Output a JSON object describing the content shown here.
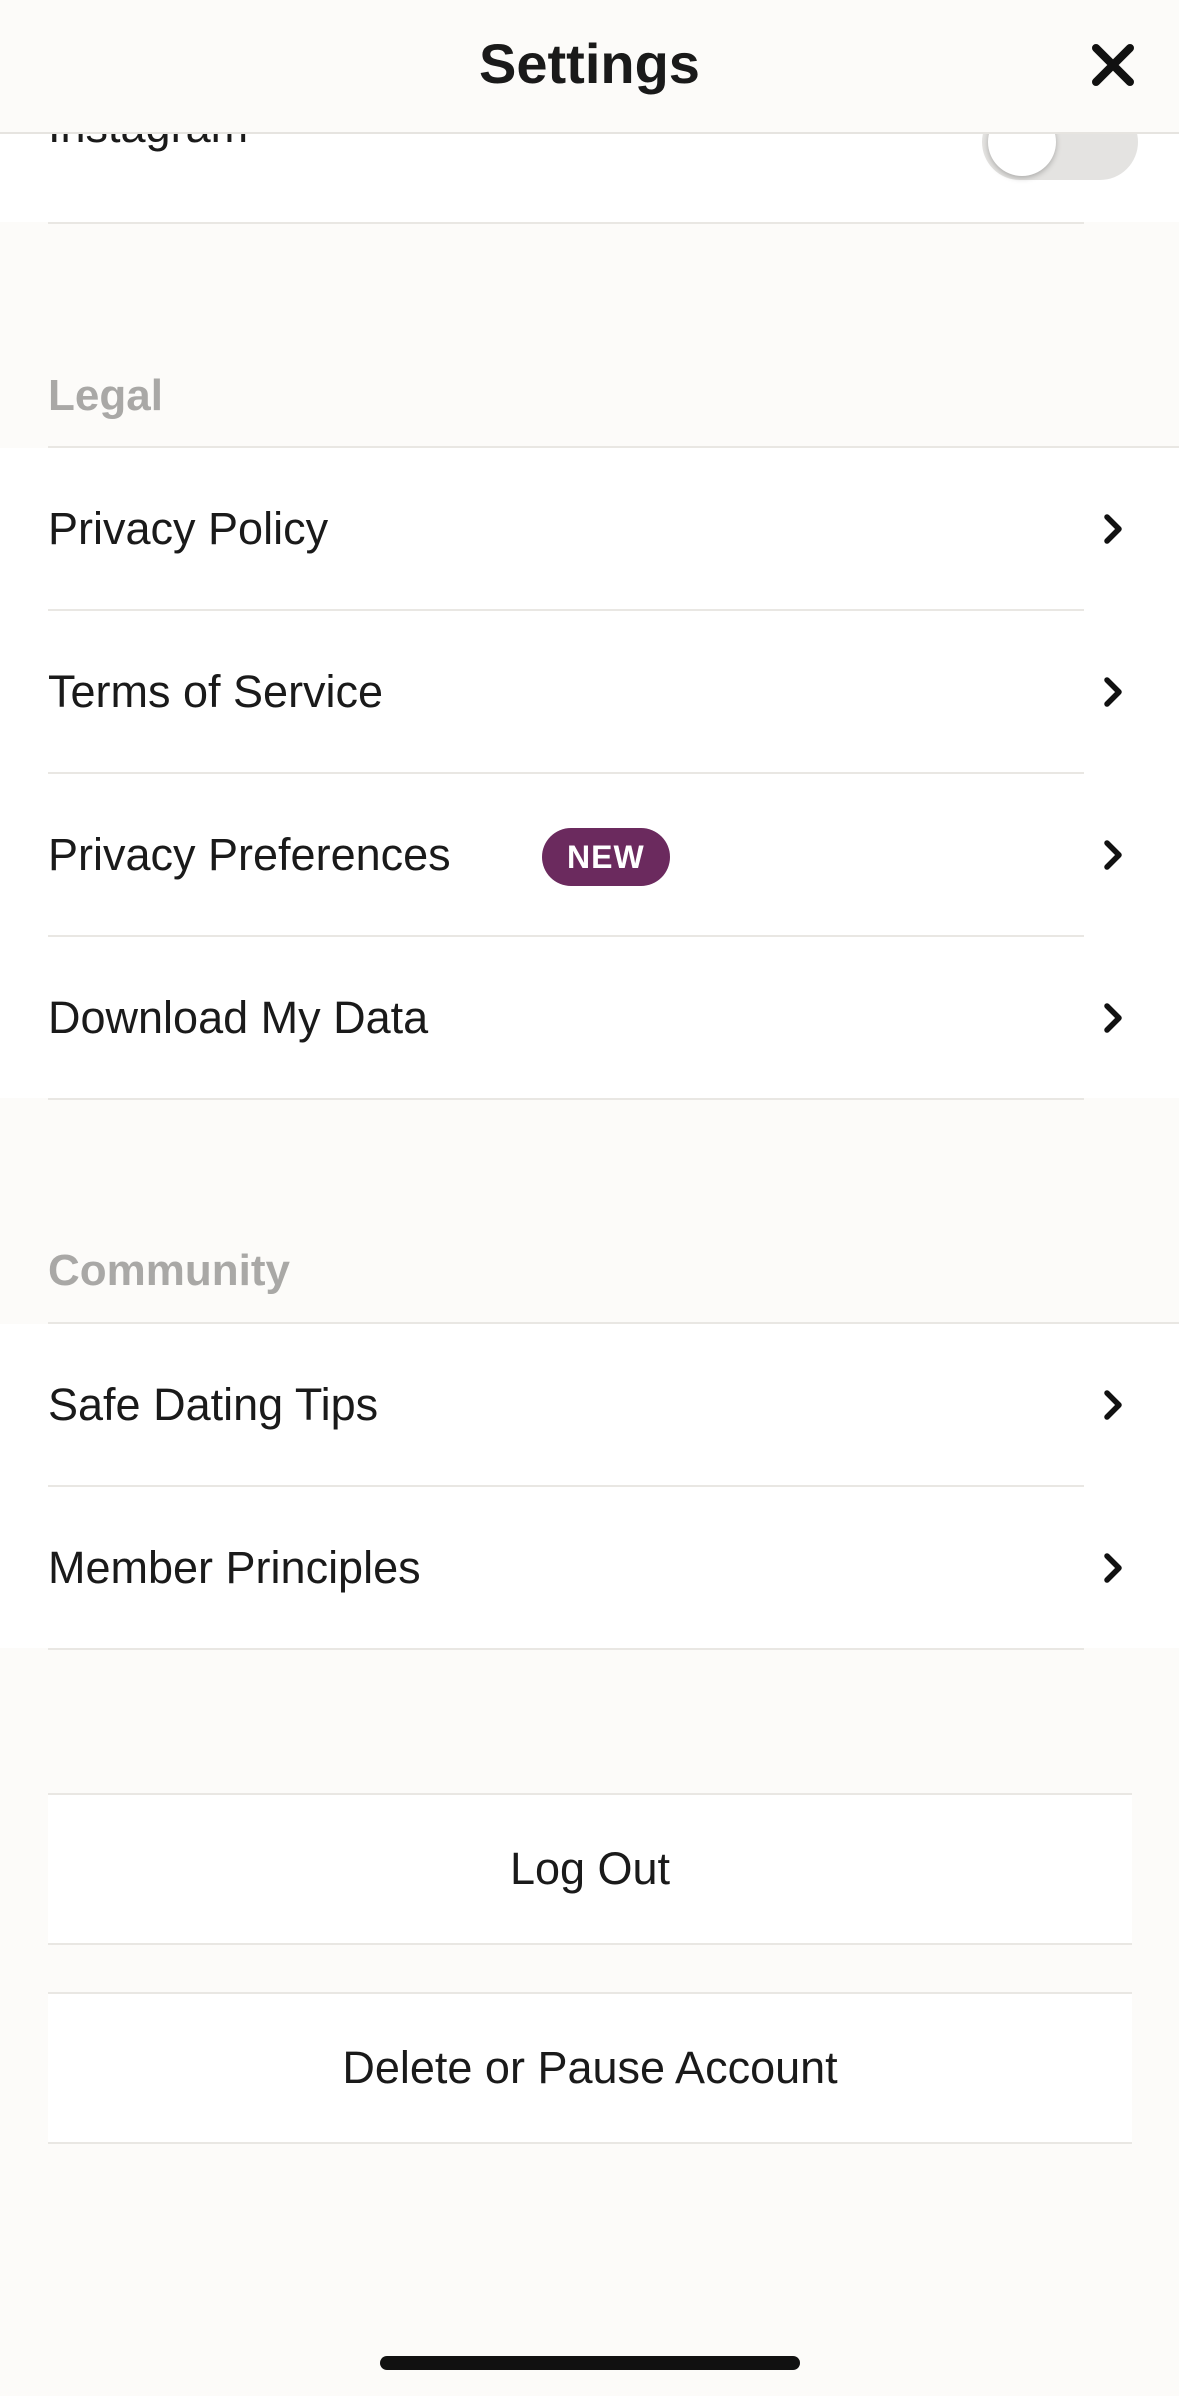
{
  "header": {
    "title": "Settings",
    "close_icon": "close-icon"
  },
  "connected_accounts": {
    "instagram_label": "Instagram",
    "instagram_enabled": false
  },
  "legal": {
    "section_title": "Legal",
    "items": [
      {
        "label": "Privacy Policy",
        "icon": "chevron-right-icon"
      },
      {
        "label": "Terms of Service",
        "icon": "chevron-right-icon"
      },
      {
        "label": "Privacy Preferences",
        "badge": "NEW",
        "icon": "chevron-right-icon"
      },
      {
        "label": "Download My Data",
        "icon": "chevron-right-icon"
      }
    ]
  },
  "community": {
    "section_title": "Community",
    "items": [
      {
        "label": "Safe Dating Tips",
        "icon": "chevron-right-icon"
      },
      {
        "label": "Member Principles",
        "icon": "chevron-right-icon"
      }
    ]
  },
  "actions": {
    "logout_label": "Log Out",
    "delete_label": "Delete or Pause Account"
  },
  "colors": {
    "background": "#fcfbf9",
    "badge": "#6b2a5e",
    "section_title": "#a9a8a6"
  }
}
